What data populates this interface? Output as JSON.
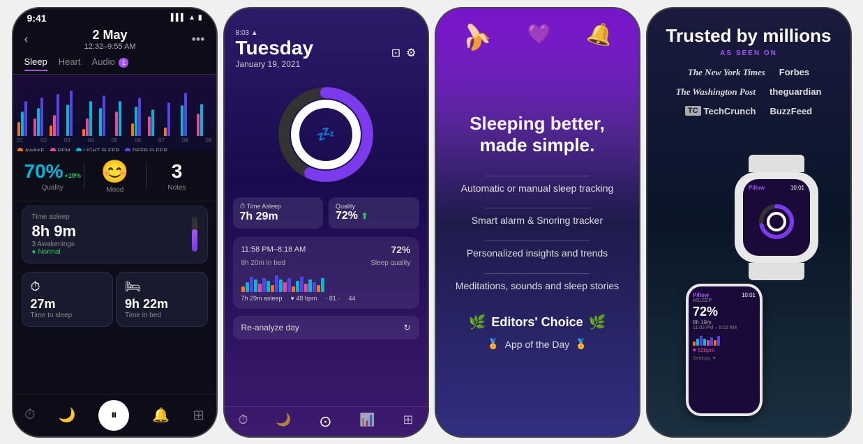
{
  "screenshots": {
    "phone1": {
      "status_time": "9:41",
      "date": "2 May",
      "time_range": "12:32–9:55 AM",
      "tabs": [
        "Sleep",
        "Heart",
        "Audio"
      ],
      "active_tab": "Sleep",
      "audio_badge": "1",
      "chart_hours": [
        "01",
        "02",
        "03",
        "04",
        "05",
        "06",
        "07",
        "08",
        "09"
      ],
      "legend": [
        {
          "label": "AWAKE",
          "color": "#f97316"
        },
        {
          "label": "REM",
          "color": "#ec4899"
        },
        {
          "label": "LIGHT SLEEP",
          "color": "#06b6d4"
        },
        {
          "label": "DEEP SLEEP",
          "color": "#4f46e5"
        }
      ],
      "quality": "70%",
      "quality_change": "+19%",
      "mood_icon": "😊",
      "notes": "3",
      "time_asleep_label": "Time asleep",
      "time_asleep": "8h 9m",
      "awakenings": "3 Awakenings",
      "normal": "Normal",
      "time_to_sleep_label": "Time to sleep",
      "time_to_sleep": "27m",
      "time_in_bed_label": "Time in bed",
      "time_in_bed": "9h 22m",
      "quality_label": "Quality",
      "mood_label": "Mood",
      "notes_label": "Notes"
    },
    "phone2": {
      "status_time": "8:03",
      "day": "Tuesday",
      "date": "January 19, 2021",
      "time_asleep_label": "Time Asleep",
      "time_asleep": "7h 29m",
      "quality_label": "Quality",
      "quality_val": "72%",
      "time_range": "11:58 PM–8:18 AM",
      "bed_time": "8h 20m in bed",
      "sleep_quality_label": "Sleep quality",
      "sleep_quality_val": "72%",
      "bpm": "♥ 48 bpm",
      "stat2": "· 81 ·",
      "stat3": "44",
      "asleep_time": "7h 29m asleep",
      "reanalyze": "Re-analyze day"
    },
    "phone3": {
      "hero": "Sleeping better, made simple.",
      "features": [
        "Automatic or manual sleep tracking",
        "Smart alarm & Snoring tracker",
        "Personalized insights and trends",
        "Meditations, sounds and sleep stories"
      ],
      "editors_choice": "Editors' Choice",
      "app_of_day": "App of the Day"
    },
    "phone4": {
      "trusted_title": "Trusted by millions",
      "as_seen_on": "AS SEEN ON",
      "media": [
        "The New York Times",
        "Forbes",
        "The Washington Post",
        "theguardian",
        "TechCrunch",
        "BuzzFeed"
      ],
      "watch_app": "Pillow",
      "watch_asleep": "ASLEEP",
      "watch_time": "10:01",
      "watch_pct": "72%",
      "watch_sleep_time": "8h 19m",
      "watch_time_range": "11:03 PM – 9:02 AM",
      "watch_heart": "♥ 52bpm",
      "small_app": "Pillow",
      "small_time": "10:01"
    }
  }
}
